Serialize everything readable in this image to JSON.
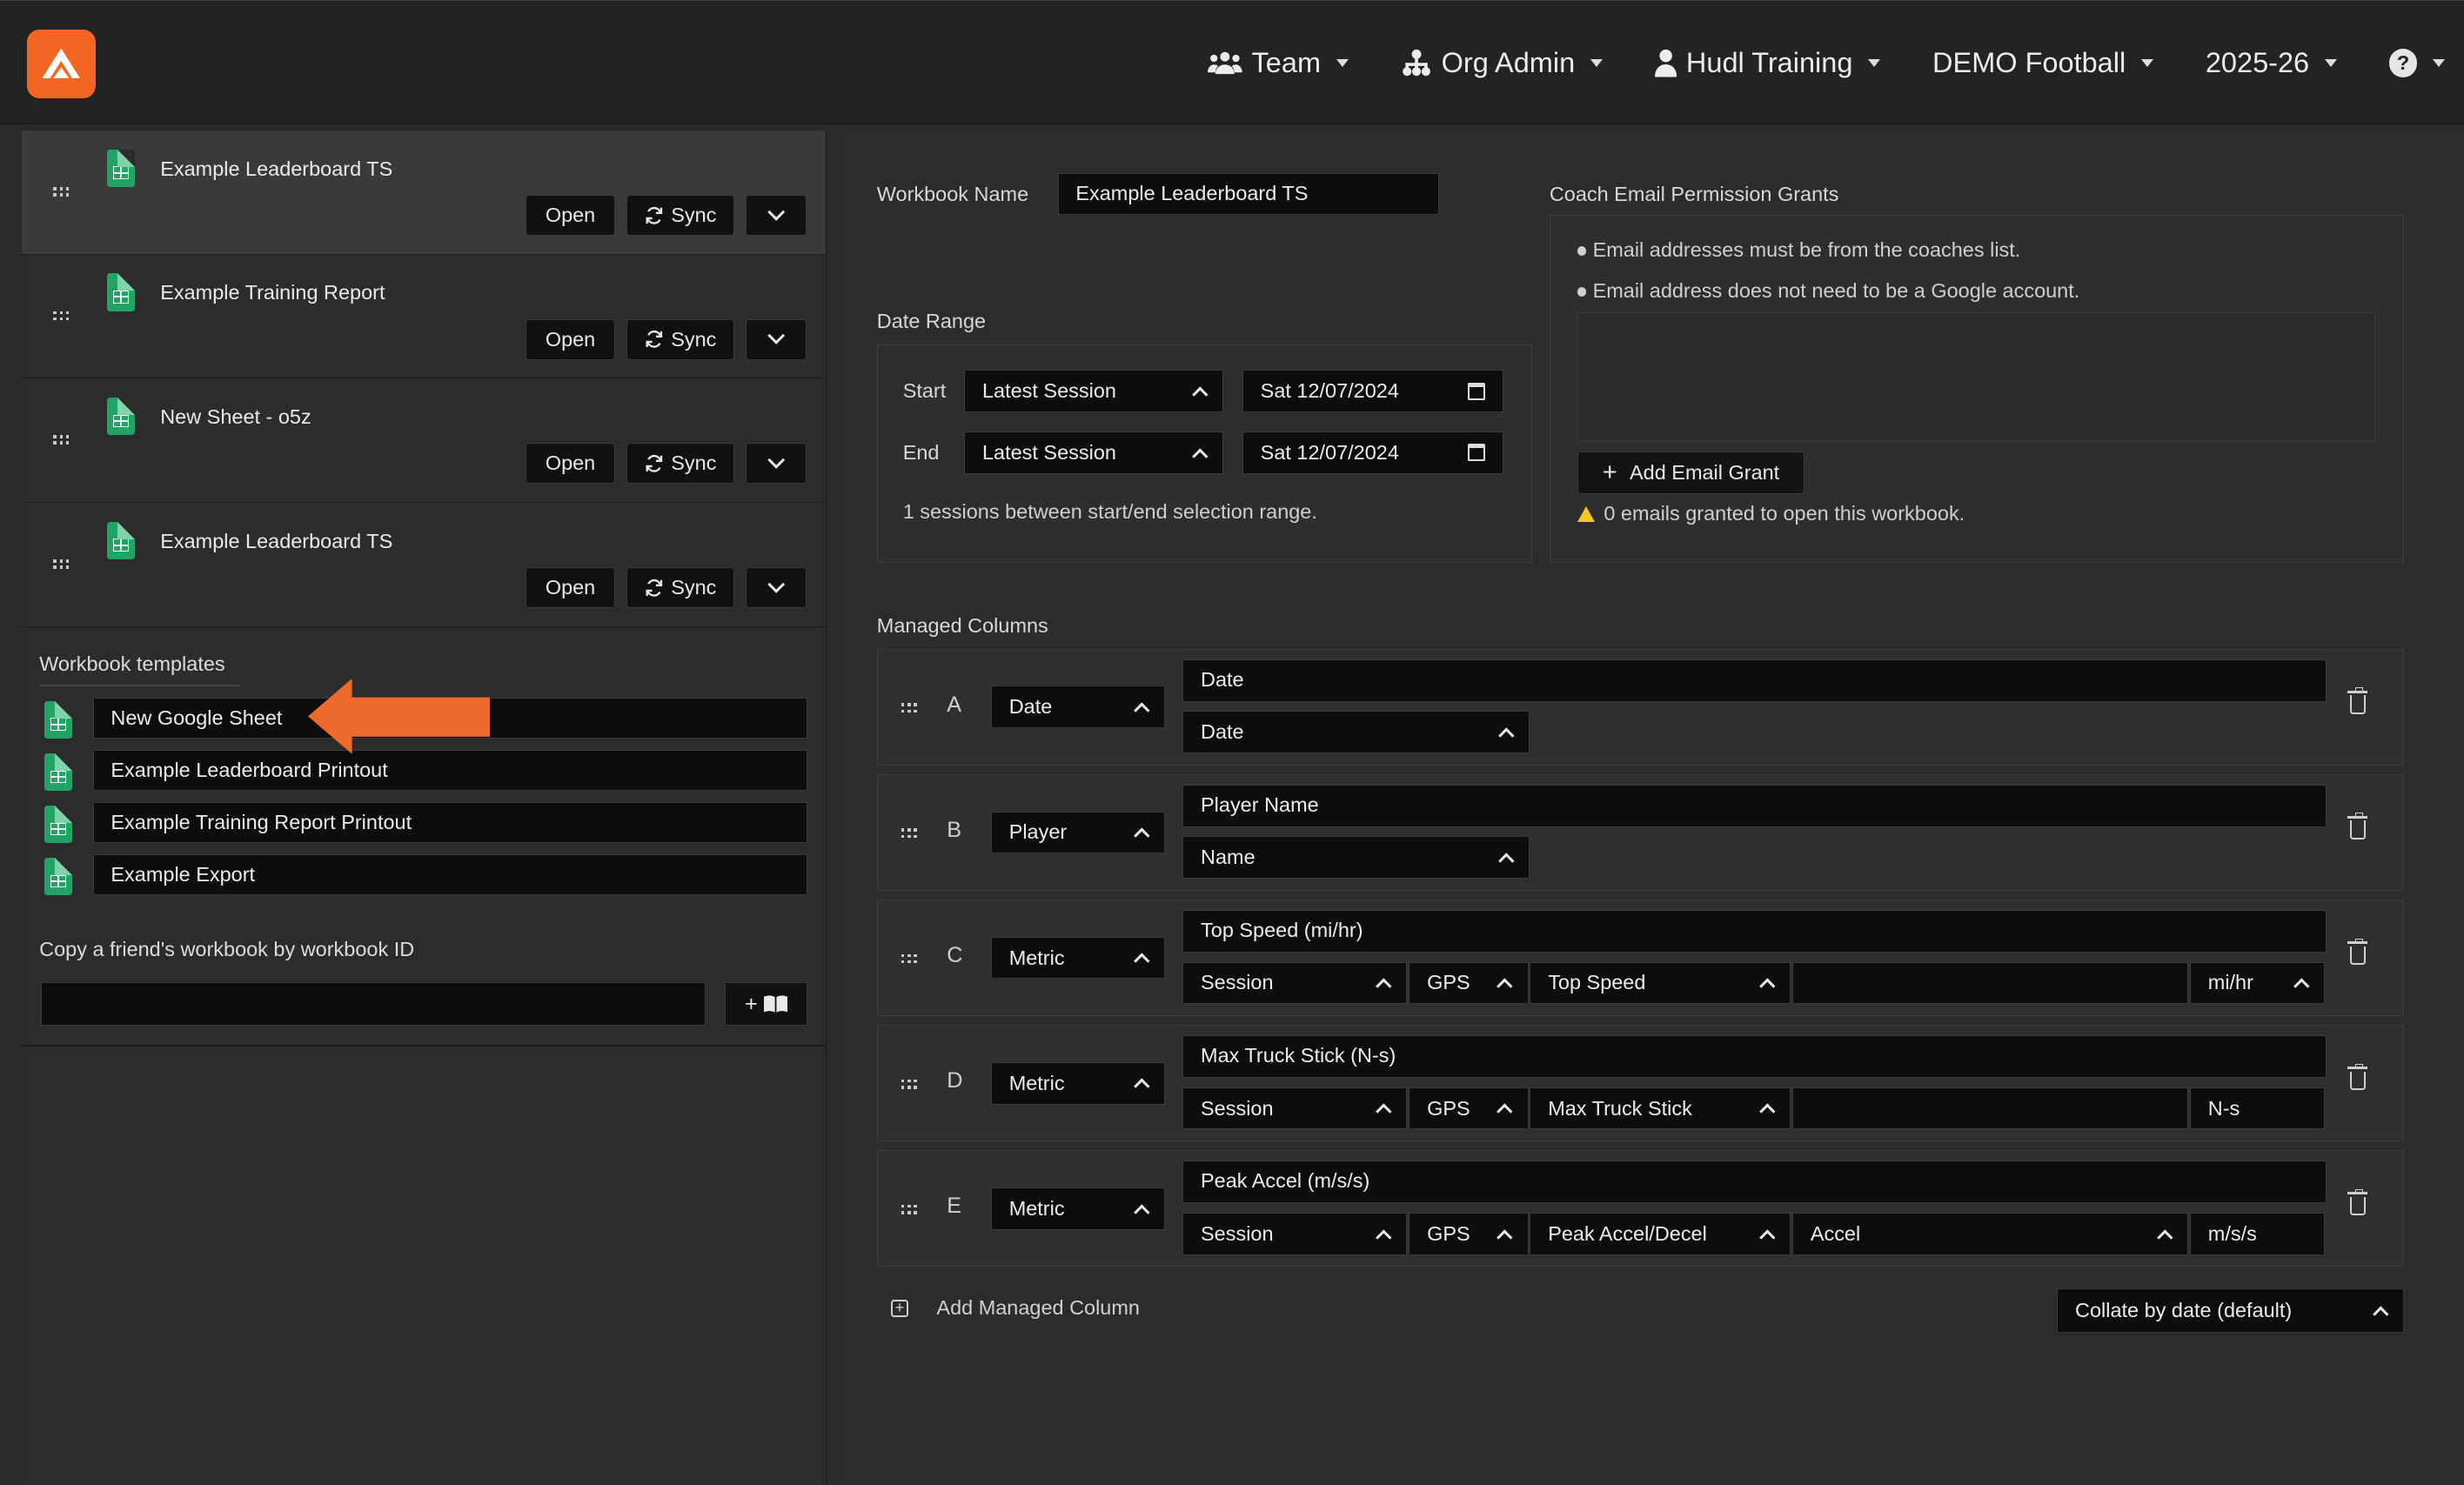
{
  "header": {
    "nav": [
      {
        "icon": "users-icon",
        "label": "Team"
      },
      {
        "icon": "org-chart-icon",
        "label": "Org Admin"
      },
      {
        "icon": "user-icon",
        "label": "Hudl Training"
      },
      {
        "icon": "",
        "label": "DEMO Football"
      },
      {
        "icon": "",
        "label": "2025-26"
      }
    ],
    "help_icon": "?",
    "brand_color": "#f26522"
  },
  "workbooks": [
    {
      "title": "Example Leaderboard TS",
      "open": "Open",
      "sync": "Sync",
      "active": true
    },
    {
      "title": "Example Training Report",
      "open": "Open",
      "sync": "Sync",
      "active": false
    },
    {
      "title": "New Sheet - o5z",
      "open": "Open",
      "sync": "Sync",
      "active": false
    },
    {
      "title": "Example Leaderboard TS",
      "open": "Open",
      "sync": "Sync",
      "active": false
    }
  ],
  "templates": {
    "heading": "Workbook templates",
    "items": [
      "New Google Sheet",
      "Example Leaderboard Printout",
      "Example Training Report Printout",
      "Example Export"
    ]
  },
  "copy": {
    "heading": "Copy a friend's workbook by workbook ID",
    "value": "",
    "button_icon": "+"
  },
  "editor": {
    "workbook_name_label": "Workbook Name",
    "workbook_name": "Example Leaderboard TS",
    "date_range_label": "Date Range",
    "start_label": "Start",
    "end_label": "End",
    "start_mode": "Latest Session",
    "end_mode": "Latest Session",
    "start_date": "Sat 12/07/2024",
    "end_date": "Sat 12/07/2024",
    "sessions_note": "1 sessions between start/end selection range.",
    "grants_label": "Coach Email Permission Grants",
    "grant_note_1": "Email addresses must be from the coaches list.",
    "grant_note_2": "Email address does not need to be a Google account.",
    "add_grant": "Add Email Grant",
    "grants_status": "0 emails granted to open this workbook.",
    "managed_columns_label": "Managed Columns",
    "add_column": "Add Managed Column",
    "collate": "Collate by date (default)"
  },
  "columns": [
    {
      "letter": "A",
      "type": "Date",
      "name": "Date",
      "subs": [
        "Date"
      ]
    },
    {
      "letter": "B",
      "type": "Player",
      "name": "Player Name",
      "subs": [
        "Name"
      ]
    },
    {
      "letter": "C",
      "type": "Metric",
      "name": "Top Speed (mi/hr)",
      "subs": [
        "Session",
        "GPS",
        "Top Speed",
        "",
        "mi/hr"
      ]
    },
    {
      "letter": "D",
      "type": "Metric",
      "name": "Max Truck Stick (N-s)",
      "subs": [
        "Session",
        "GPS",
        "Max Truck Stick",
        "",
        "N-s"
      ]
    },
    {
      "letter": "E",
      "type": "Metric",
      "name": "Peak Accel (m/s/s)",
      "subs": [
        "Session",
        "GPS",
        "Peak Accel/Decel",
        "Accel",
        "m/s/s"
      ]
    }
  ]
}
